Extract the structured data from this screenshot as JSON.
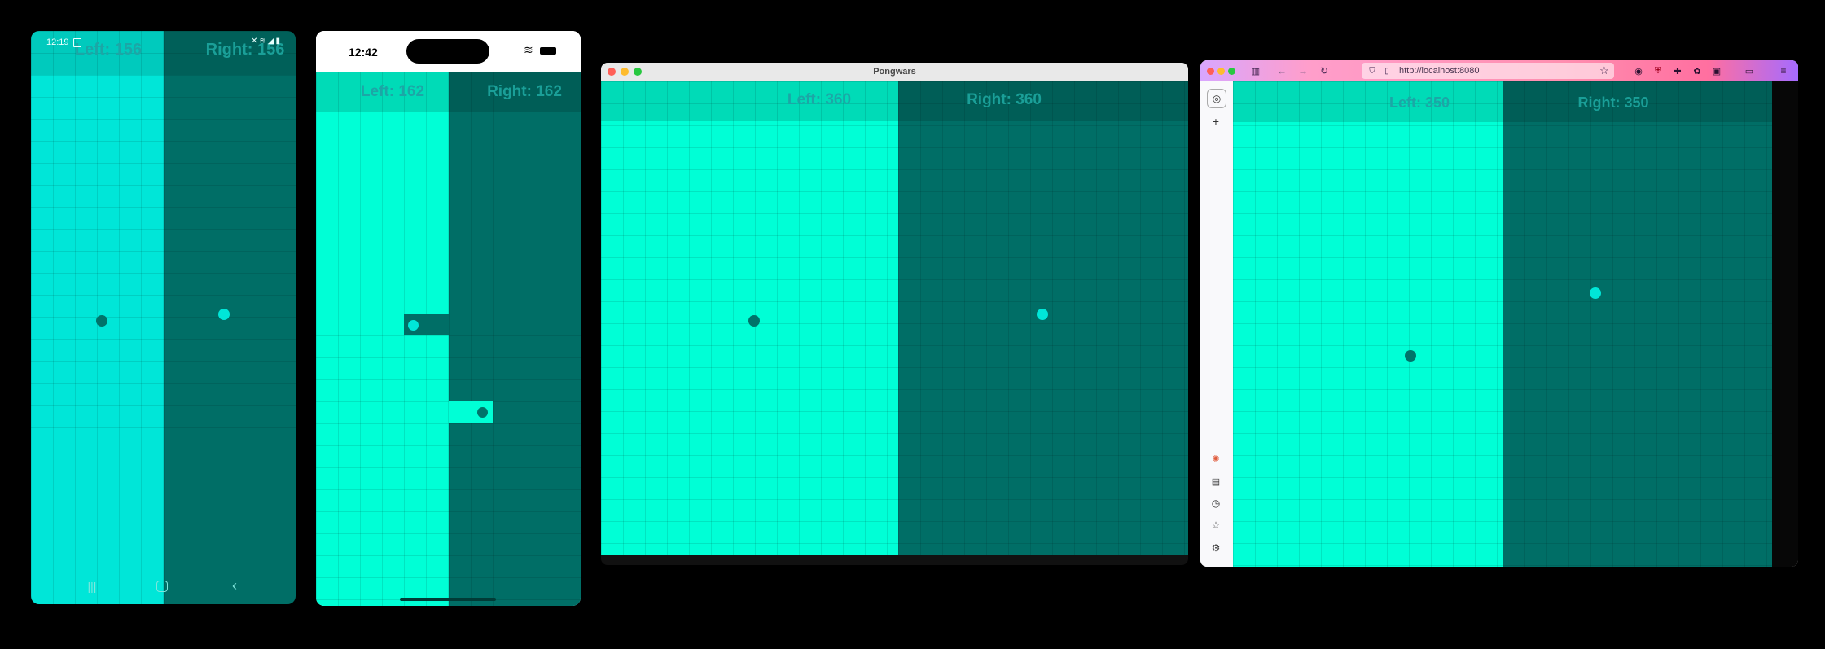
{
  "android": {
    "status_time": "12:19",
    "status_icons": [
      "sim-card-icon",
      "mute-icon",
      "wifi-icon",
      "signal-icon",
      "battery-icon"
    ],
    "left_score": "Left: 156",
    "right_score": "Right: 156",
    "nav_icons": [
      "recents-icon",
      "home-icon",
      "back-icon"
    ]
  },
  "iphone": {
    "status_time": "12:42",
    "left_score": "Left: 162",
    "right_score": "Right: 162"
  },
  "mac_app": {
    "window_title": "Pongwars",
    "left_score": "Left: 360",
    "right_score": "Right: 360"
  },
  "browser": {
    "url": "http://localhost:8080",
    "left_score": "Left: 350",
    "right_score": "Right: 350",
    "sidebar_icons": [
      "globe-icon",
      "plus-icon",
      "extension-icon",
      "screenshot-icon",
      "history-icon",
      "bookmark-icon",
      "settings-icon"
    ]
  },
  "colors": {
    "day": "#00ffd6",
    "night": "#006e66",
    "day_ball": "#00736a",
    "night_ball": "#00e6d8"
  }
}
